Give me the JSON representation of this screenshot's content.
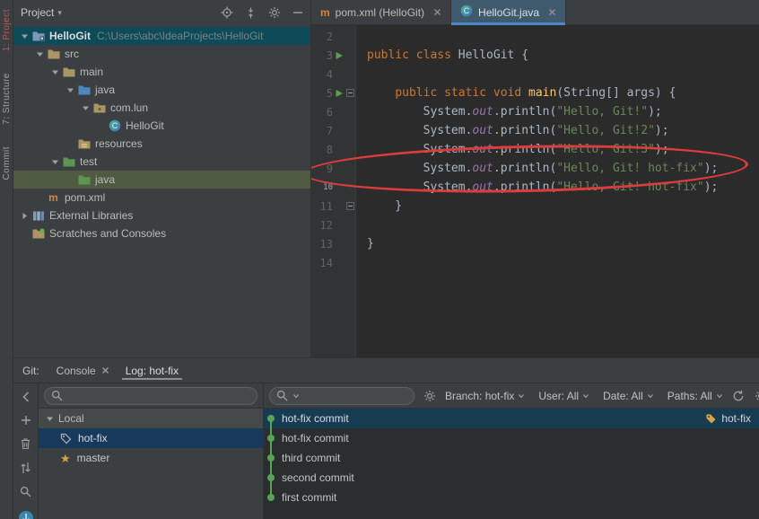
{
  "colors": {
    "panel_bg": "#3c3f41",
    "editor_bg": "#2b2b2b",
    "gutter_bg": "#313335",
    "accent_blue": "#4a88c7",
    "selection_teal": "#0d4b59",
    "selection_green": "#4e5b41",
    "selection_blue": "#16395c",
    "selection_commit": "#173c52",
    "annotation_red": "#dd3c3c",
    "graph_green": "#57a457",
    "tag_gold": "#d9a343",
    "syntax_keyword": "#cc7832",
    "syntax_string": "#6a8759",
    "syntax_field": "#9876aa",
    "syntax_method": "#ffc66d",
    "syntax_text": "#a9b7c6"
  },
  "stripe": {
    "labels": [
      {
        "text": "1: Project",
        "active": true
      },
      {
        "text": "7: Structure",
        "active": false
      },
      {
        "text": "Commit",
        "active": false
      }
    ]
  },
  "project": {
    "header": {
      "title": "Project",
      "icons": [
        {
          "icon": "target",
          "name": "locate-file-icon"
        },
        {
          "icon": "collapse",
          "name": "collapse-all-icon"
        },
        {
          "icon": "gear",
          "name": "settings-gear-icon"
        },
        {
          "icon": "minus",
          "name": "hide-panel-icon"
        }
      ]
    },
    "tree": [
      {
        "label": "HelloGit",
        "sub": "C:\\Users\\abc\\IdeaProjects\\HelloGit",
        "indent": 0,
        "arrow": "open",
        "icon": "project",
        "selected": "teal",
        "bold": true
      },
      {
        "label": "src",
        "indent": 1,
        "arrow": "open",
        "icon": "folder"
      },
      {
        "label": "main",
        "indent": 2,
        "arrow": "open",
        "icon": "folder"
      },
      {
        "label": "java",
        "indent": 3,
        "arrow": "open",
        "icon": "folder-src"
      },
      {
        "label": "com.lun",
        "indent": 4,
        "arrow": "open",
        "icon": "package"
      },
      {
        "label": "HelloGit",
        "indent": 5,
        "arrow": "none",
        "icon": "class"
      },
      {
        "label": "resources",
        "indent": 3,
        "arrow": "none",
        "icon": "folder-res"
      },
      {
        "label": "test",
        "indent": 2,
        "arrow": "open",
        "icon": "folder-test"
      },
      {
        "label": "java",
        "indent": 3,
        "arrow": "none",
        "icon": "folder-test",
        "selected": "green"
      },
      {
        "label": "pom.xml",
        "indent": 1,
        "arrow": "none",
        "icon": "maven"
      },
      {
        "label": "External Libraries",
        "indent": 0,
        "arrow": "closed",
        "icon": "lib"
      },
      {
        "label": "Scratches and Consoles",
        "indent": 0,
        "arrow": "none",
        "icon": "scratch"
      }
    ]
  },
  "editor": {
    "tabs": [
      {
        "label": "pom.xml (HelloGit)",
        "icon": "maven",
        "active": false
      },
      {
        "label": "HelloGit.java",
        "icon": "class",
        "active": true
      }
    ],
    "code": [
      {
        "n": 2,
        "tokens": []
      },
      {
        "n": 3,
        "run": true,
        "tokens": [
          [
            "kw",
            "public class "
          ],
          [
            "plain",
            "HelloGit {"
          ]
        ]
      },
      {
        "n": 4,
        "tokens": []
      },
      {
        "n": 5,
        "run": true,
        "fold": true,
        "tokens": [
          [
            "plain",
            "    "
          ],
          [
            "kw",
            "public static void "
          ],
          [
            "fn",
            "main"
          ],
          [
            "plain",
            "(String[] args) {"
          ]
        ]
      },
      {
        "n": 6,
        "tokens": [
          [
            "plain",
            "        System."
          ],
          [
            "field",
            "out"
          ],
          [
            "plain",
            ".println("
          ],
          [
            "str",
            "\"Hello, Git!\""
          ],
          [
            "plain",
            ");"
          ]
        ]
      },
      {
        "n": 7,
        "tokens": [
          [
            "plain",
            "        System."
          ],
          [
            "field",
            "out"
          ],
          [
            "plain",
            ".println("
          ],
          [
            "str",
            "\"Hello, Git!2\""
          ],
          [
            "plain",
            ");"
          ]
        ]
      },
      {
        "n": 8,
        "tokens": [
          [
            "plain",
            "        System."
          ],
          [
            "field",
            "out"
          ],
          [
            "plain",
            ".println("
          ],
          [
            "str",
            "\"Hello, Git!3\""
          ],
          [
            "plain",
            ");"
          ]
        ]
      },
      {
        "n": 9,
        "tokens": [
          [
            "plain",
            "        System."
          ],
          [
            "field",
            "out"
          ],
          [
            "plain",
            ".println("
          ],
          [
            "str",
            "\"Hello, Git! hot-fix\""
          ],
          [
            "plain",
            ");"
          ]
        ]
      },
      {
        "n": 10,
        "caret": true,
        "tokens": [
          [
            "plain",
            "        System."
          ],
          [
            "field",
            "out"
          ],
          [
            "plain",
            ".println("
          ],
          [
            "str",
            "\"Hello, Git! hot-fix\""
          ],
          [
            "plain",
            ");"
          ]
        ]
      },
      {
        "n": 11,
        "fold": true,
        "tokens": [
          [
            "plain",
            "    }"
          ]
        ]
      },
      {
        "n": 12,
        "tokens": []
      },
      {
        "n": 13,
        "tokens": [
          [
            "plain",
            "}"
          ]
        ]
      },
      {
        "n": 14,
        "tokens": []
      }
    ],
    "annotation": {
      "shape": "ellipse",
      "target_line": 10
    }
  },
  "git": {
    "label": "Git:",
    "tabs": [
      {
        "label": "Console",
        "close": true,
        "active": false
      },
      {
        "label": "Log: hot-fix",
        "close": false,
        "active": true
      }
    ],
    "strip": [
      {
        "icon": "chevron-left",
        "name": "collapse-panel-icon"
      },
      {
        "icon": "plus",
        "name": "new-branch-icon"
      },
      {
        "icon": "trash",
        "name": "delete-icon"
      },
      {
        "icon": "compare",
        "name": "compare-branches-icon"
      },
      {
        "icon": "search",
        "name": "search-icon"
      },
      {
        "icon": "git-blue",
        "name": "git-toolwindow-icon",
        "bottom": true
      }
    ],
    "branch_search": {
      "value": "",
      "placeholder": ""
    },
    "commit_search": {
      "value": "",
      "placeholder": ""
    },
    "filters": [
      {
        "name": "branch",
        "label": "Branch: hot-fix"
      },
      {
        "name": "user",
        "label": "User: All"
      },
      {
        "name": "date",
        "label": "Date: All"
      },
      {
        "name": "paths",
        "label": "Paths: All"
      }
    ],
    "branches": {
      "group": "Local",
      "items": [
        {
          "label": "hot-fix",
          "icon": "tag-gray",
          "selected": true
        },
        {
          "label": "master",
          "icon": "star",
          "selected": false
        }
      ]
    },
    "commits": [
      {
        "message": "hot-fix commit",
        "selected": true,
        "ref": "hot-fix"
      },
      {
        "message": "hot-fix commit",
        "selected": false
      },
      {
        "message": "third commit",
        "selected": false
      },
      {
        "message": "second commit",
        "selected": false
      },
      {
        "message": "first commit",
        "selected": false
      }
    ]
  }
}
